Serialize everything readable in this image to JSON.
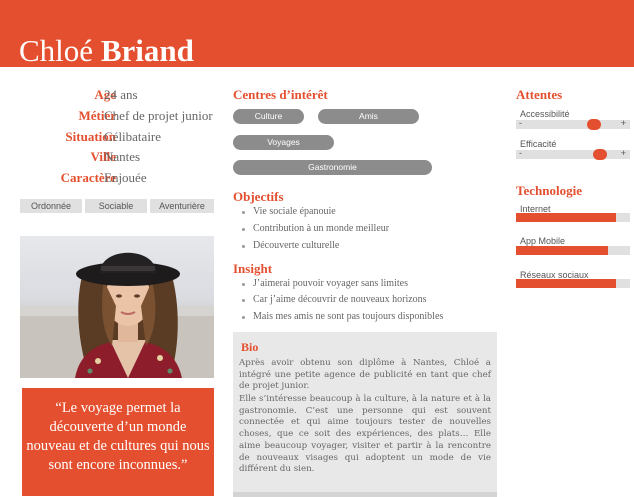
{
  "persona": {
    "first_name": "Chloé",
    "last_name": "Briand"
  },
  "info": [
    {
      "key": "Age",
      "value": "24 ans"
    },
    {
      "key": "Métier",
      "value": "Chef de projet junior"
    },
    {
      "key": "Situation",
      "value": "Célibataire"
    },
    {
      "key": "Ville",
      "value": "Nantes"
    },
    {
      "key": "Caractère",
      "value": "Enjouée"
    }
  ],
  "traits": [
    "Ordonnée",
    "Sociable",
    "Aventurière"
  ],
  "quote": "“Le voyage permet la découverte d’un monde nouveau et de cultures qui nous sont encore inconnues.”",
  "interests": {
    "title": "Centres d’intérêt",
    "tags": [
      "Culture",
      "Amis",
      "Voyages",
      "Gastronomie"
    ]
  },
  "objectives": {
    "title": "Objectifs",
    "items": [
      "Vie sociale épanouie",
      "Contribution à un monde meilleur",
      "Découverte culturelle"
    ]
  },
  "insight": {
    "title": "Insight",
    "items": [
      "J’aimerai pouvoir voyager sans limites",
      "Car j’aime découvrir de nouveaux horizons",
      "Mais mes amis ne sont pas toujours disponibles"
    ]
  },
  "bio": {
    "title": "Bio",
    "paragraph1": "Après avoir obtenu son diplôme à Nantes, Chloé a intégré une petite agence de publicité en tant que chef de projet junior.",
    "paragraph2": "Elle s’intéresse beaucoup à la culture, à la nature et à la gastronomie. C’est une personne qui est souvent connectée et qui aime toujours tester de nouvelles choses, que ce soit des expériences, des plats… Elle aime beaucoup voyager, visiter et partir à la rencontre de nouveaux visages qui adoptent un mode de vie différent du sien."
  },
  "expectations": {
    "title": "Attentes",
    "items": [
      {
        "label": "Accessibilité",
        "level": 0.68
      },
      {
        "label": "Efficacité",
        "level": 0.74
      }
    ],
    "minus": "-",
    "plus": "+"
  },
  "technology": {
    "title": "Technologie",
    "items": [
      {
        "label": "Internet",
        "level": 0.88
      },
      {
        "label": "App Mobile",
        "level": 0.81
      },
      {
        "label": "Réseaux sociaux",
        "level": 0.88
      }
    ]
  },
  "colors": {
    "accent": "#e4502f",
    "pill": "#8c8c8c",
    "panel": "#e8e8e8"
  }
}
